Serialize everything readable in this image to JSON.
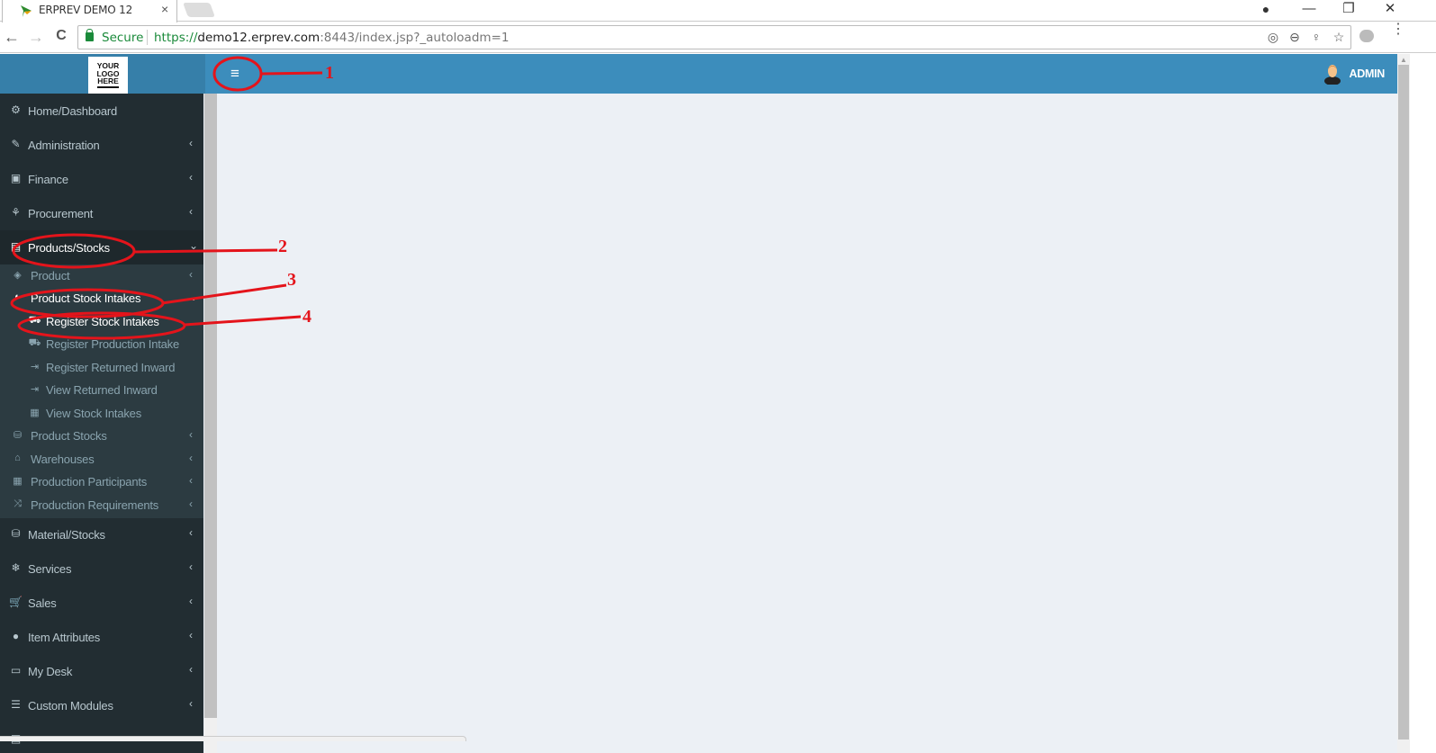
{
  "browser": {
    "tab_title": "ERPREV DEMO 12",
    "tab_close": "×",
    "secure_label": "Secure",
    "url_scheme": "https://",
    "url_host": "demo12.erprev.com",
    "url_rest": ":8443/index.jsp?_autoloadm=1",
    "back": "←",
    "forward": "→",
    "reload": "C",
    "account_icon": "●",
    "minimize": "—",
    "restore": "❐",
    "close": "✕",
    "location_icon": "◎",
    "zoom_icon": "⊖",
    "key_icon": "♀",
    "star_icon": "☆",
    "menu": "⋮"
  },
  "header": {
    "logo_lines": [
      "YOUR",
      "LOGO",
      "HERE"
    ],
    "toggle_icon": "≡",
    "user_name": "ADMIN",
    "accent": "#3c8dbc"
  },
  "sidebar": {
    "items": [
      {
        "label": "Home/Dashboard",
        "icon": "⚙",
        "chev": ""
      },
      {
        "label": "Administration",
        "icon": "✎",
        "chev": "‹"
      },
      {
        "label": "Finance",
        "icon": "▣",
        "chev": "‹"
      },
      {
        "label": "Procurement",
        "icon": "⚘",
        "chev": "‹"
      },
      {
        "label": "Products/Stocks",
        "icon": "▤",
        "chev": "⌄"
      },
      {
        "label": "Material/Stocks",
        "icon": "⛁",
        "chev": "‹"
      },
      {
        "label": "Services",
        "icon": "❄",
        "chev": "‹"
      },
      {
        "label": "Sales",
        "icon": "🛒",
        "chev": "‹"
      },
      {
        "label": "Item Attributes",
        "icon": "●",
        "chev": "‹"
      },
      {
        "label": "My Desk",
        "icon": "▭",
        "chev": "‹"
      },
      {
        "label": "Custom Modules",
        "icon": "☰",
        "chev": "‹"
      },
      {
        "label": "",
        "icon": "▤",
        "chev": "‹"
      }
    ],
    "submenu": [
      {
        "label": "Product",
        "icon": "◈",
        "chev": "‹"
      },
      {
        "label": "Product Stock Intakes",
        "icon": "◐",
        "chev": "⌄"
      },
      {
        "label": "Product Stocks",
        "icon": "⛁",
        "chev": "‹"
      },
      {
        "label": "Warehouses",
        "icon": "⌂",
        "chev": "‹"
      },
      {
        "label": "Production Participants",
        "icon": "▦",
        "chev": "‹"
      },
      {
        "label": "Production Requirements",
        "icon": "⤨",
        "chev": "‹"
      }
    ],
    "submenu2": [
      {
        "label": "Register Stock Intakes",
        "icon": "⛟"
      },
      {
        "label": "Register Production Intake",
        "icon": "⛟"
      },
      {
        "label": "Register Returned Inward",
        "icon": "⇥"
      },
      {
        "label": "View Returned Inward",
        "icon": "⇥"
      },
      {
        "label": "View Stock Intakes",
        "icon": "▦"
      }
    ]
  },
  "annotations": [
    "1",
    "2",
    "3",
    "4"
  ]
}
